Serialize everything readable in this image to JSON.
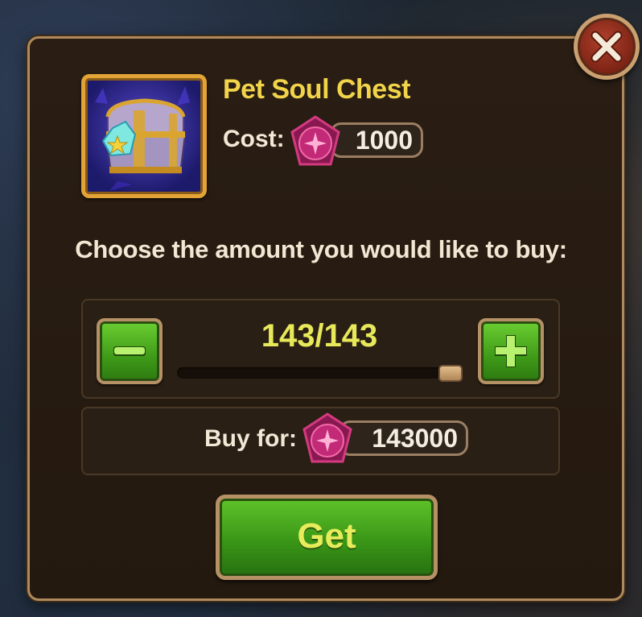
{
  "dialog": {
    "item_name": "Pet Soul Chest",
    "item_icon": "treasure-chest-icon",
    "cost_label": "Cost:",
    "cost_value": "1000",
    "currency_icon": "pink-gem-icon",
    "prompt": "Choose the amount you would like to buy:",
    "amount_display": "143/143",
    "amount_selected": 143,
    "amount_max": 143,
    "slider_fraction": 1.0,
    "buy_for_label": "Buy for:",
    "total_price": "143000",
    "get_label": "Get"
  },
  "colors": {
    "title": "#f2d44a",
    "amount": "#e7e85a",
    "button_green": "#3f9a18",
    "frame_border": "#b08a5c",
    "close_red": "#9a3020"
  }
}
